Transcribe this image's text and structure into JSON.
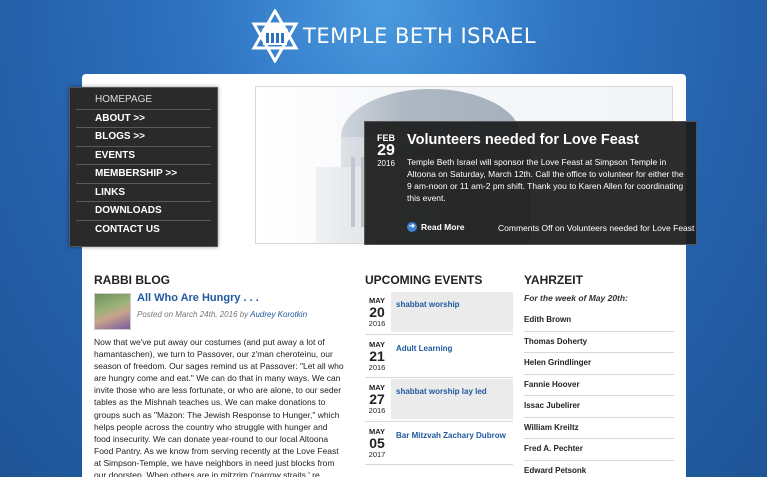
{
  "header": {
    "site_title": "TEMPLE BETH ISRAEL"
  },
  "nav": {
    "items": [
      {
        "label": "HOMEPAGE"
      },
      {
        "label": "ABOUT >>"
      },
      {
        "label": "BLOGS >>"
      },
      {
        "label": "EVENTS"
      },
      {
        "label": "MEMBERSHIP >>"
      },
      {
        "label": "LINKS"
      },
      {
        "label": "DOWNLOADS"
      },
      {
        "label": "CONTACT US"
      }
    ]
  },
  "feature": {
    "month": "FEB",
    "day": "29",
    "year": "2016",
    "title": "Volunteers needed for Love Feast",
    "body": "Temple Beth Israel will sponsor the Love Feast at Simpson Temple in Altoona on Saturday, March 12th. Call the office to volunteer for either the 9 am-noon or 11 am-2 pm shift. Thank you to Karen Allen for coordinating this event.",
    "read_more": "Read More",
    "comments": "Comments Off on Volunteers needed for Love Feast"
  },
  "rabbi_blog": {
    "heading": "RABBI BLOG",
    "post_title": "All Who Are Hungry . . .",
    "posted_on": "Posted on March 24th, 2016 by ",
    "author": "Audrey Korotkin",
    "body": "Now that we've put away our costumes (and put away a lot of hamantaschen), we turn to Passover, our z'man cheroteinu, our season of freedom. Our sages remind us at Passover: \"Let all who are hungry come and eat.\" We can do that in many ways. We can invite those who are less fortunate, or who are alone, to our seder tables as the Mishnah teaches us. We can make donations to groups such as \"Mazon: The Jewish Response to Hunger,\" which helps people across the country who struggle with hunger and food insecurity. We can donate year-round to our local Altoona Food Pantry. As we know from serving recently at the Love Feast at Simpson-Temple, we have neighbors in need just blocks from our doorstep. When others are in mitzrim ('narrow straits,' re"
  },
  "events": {
    "heading": "UPCOMING EVENTS",
    "items": [
      {
        "month": "MAY",
        "day": "20",
        "year": "2016",
        "name": "shabbat worship"
      },
      {
        "month": "MAY",
        "day": "21",
        "year": "2016",
        "name": "Adult Learning"
      },
      {
        "month": "MAY",
        "day": "27",
        "year": "2016",
        "name": "shabbat worship lay led"
      },
      {
        "month": "MAY",
        "day": "05",
        "year": "2017",
        "name": "Bar Mitzvah Zachary Dubrow"
      }
    ]
  },
  "yahrzeit": {
    "heading": "YAHRZEIT",
    "week_label": "For the week of May 20th:",
    "names": [
      "Edith Brown",
      "Thomas Doherty",
      "Helen Grindlinger",
      "Fannie Hoover",
      "Issac Jubelirer",
      "William Kreiltz",
      "Fred A. Pechter",
      "Edward Petsonk"
    ]
  },
  "colors": {
    "accent": "#1f5aa0",
    "background": "#2e72c0",
    "nav_bg": "#2a2a2a"
  }
}
